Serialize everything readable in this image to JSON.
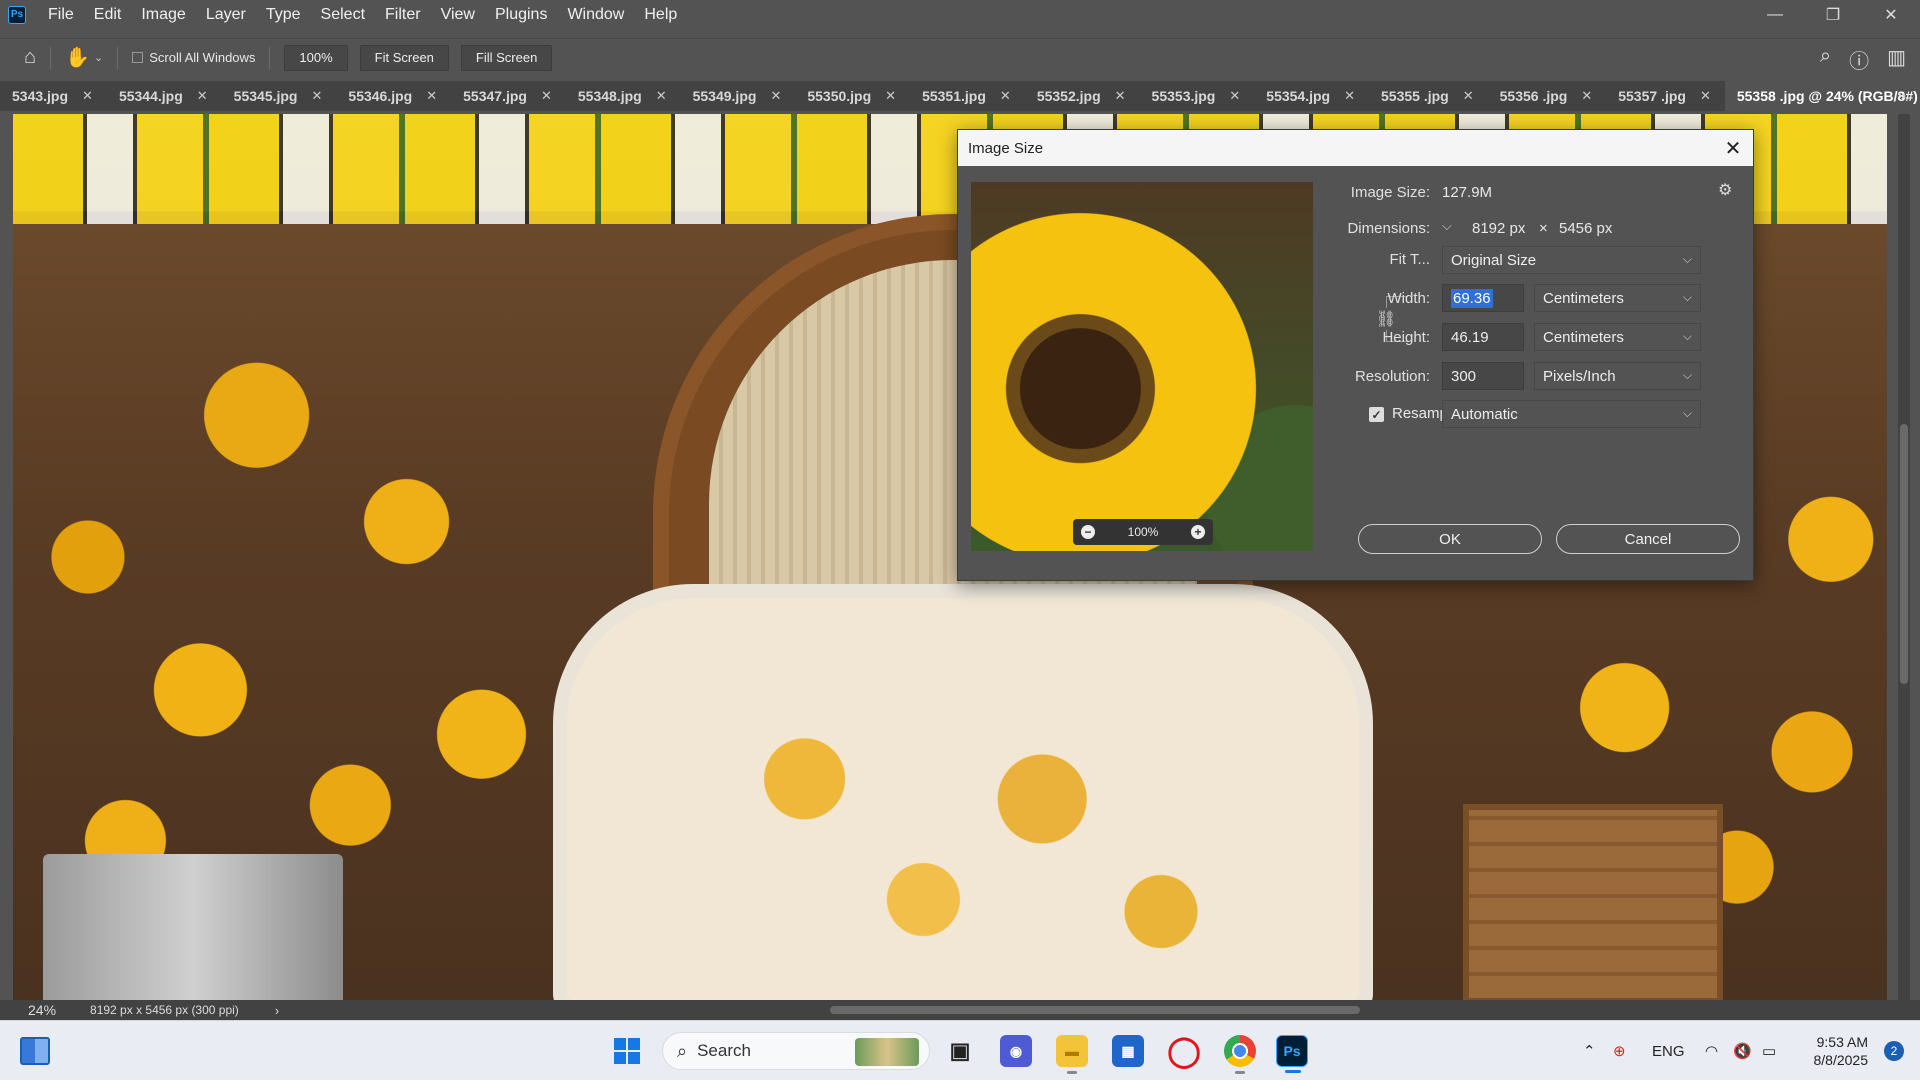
{
  "app": {
    "logo": "Ps"
  },
  "menu": [
    "File",
    "Edit",
    "Image",
    "Layer",
    "Type",
    "Select",
    "Filter",
    "View",
    "Plugins",
    "Window",
    "Help"
  ],
  "window_controls": {
    "minimize": "—",
    "maximize": "❐",
    "close": "✕"
  },
  "options": {
    "scroll_all_windows": "Scroll All Windows",
    "zoom": "100%",
    "fit_screen": "Fit Screen",
    "fill_screen": "Fill Screen"
  },
  "tabs": [
    {
      "label": "5343.jpg"
    },
    {
      "label": "55344.jpg"
    },
    {
      "label": "55345.jpg"
    },
    {
      "label": "55346.jpg"
    },
    {
      "label": "55347.jpg"
    },
    {
      "label": "55348.jpg"
    },
    {
      "label": "55349.jpg"
    },
    {
      "label": "55350.jpg"
    },
    {
      "label": "55351.jpg"
    },
    {
      "label": "55352.jpg"
    },
    {
      "label": "55353.jpg"
    },
    {
      "label": "55354.jpg"
    },
    {
      "label": "55355 .jpg"
    },
    {
      "label": "55356 .jpg"
    },
    {
      "label": "55357 .jpg"
    },
    {
      "label": "55358 .jpg @ 24% (RGB/8#)",
      "active": true
    }
  ],
  "status": {
    "zoom": "24%",
    "doc_info": "8192 px x 5456 px (300 ppi)",
    "arrow": "›"
  },
  "dialog": {
    "title": "Image Size",
    "image_size_label": "Image Size:",
    "image_size_value": "127.9M",
    "dimensions_label": "Dimensions:",
    "dim_width": "8192 px",
    "dim_x": "×",
    "dim_height": "5456 px",
    "fit_to_label": "Fit T...",
    "fit_to_value": "Original Size",
    "width_label": "Width:",
    "width_value": "69.36",
    "width_unit": "Centimeters",
    "height_label": "Height:",
    "height_value": "46.19",
    "height_unit": "Centimeters",
    "resolution_label": "Resolution:",
    "resolution_value": "300",
    "resolution_unit": "Pixels/Inch",
    "resample_label": "Resample:",
    "resample_checked": true,
    "resample_value": "Automatic",
    "preview_zoom": "100%",
    "ok": "OK",
    "cancel": "Cancel"
  },
  "taskbar": {
    "search": "Search",
    "language": "ENG",
    "time": "9:53 AM",
    "date": "8/8/2025",
    "notifications": "2"
  }
}
